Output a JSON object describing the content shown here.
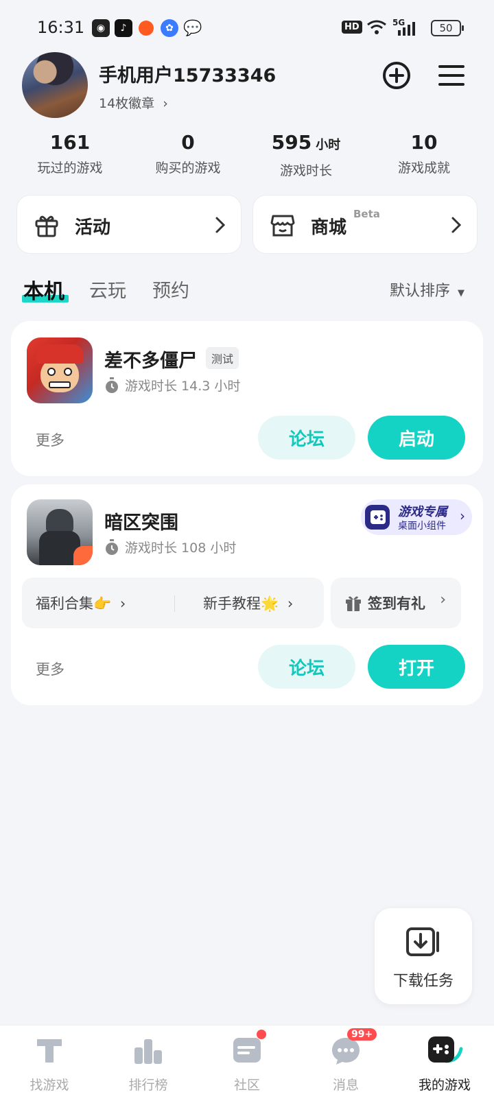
{
  "status": {
    "time": "16:31",
    "network": "5G",
    "battery": "50",
    "hd_label": "HD"
  },
  "profile": {
    "username": "手机用户15733346",
    "badges": "14枚徽章"
  },
  "stats": [
    {
      "value": "161",
      "unit": "",
      "label": "玩过的游戏"
    },
    {
      "value": "0",
      "unit": "",
      "label": "购买的游戏"
    },
    {
      "value": "595",
      "unit": "小时",
      "label": "游戏时长"
    },
    {
      "value": "10",
      "unit": "",
      "label": "游戏成就"
    }
  ],
  "shortcuts": {
    "activity": "活动",
    "store": "商城",
    "store_beta": "Beta"
  },
  "tabs": [
    {
      "label": "本机",
      "active": true
    },
    {
      "label": "云玩",
      "active": false
    },
    {
      "label": "预约",
      "active": false
    }
  ],
  "sort": "默认排序",
  "games": [
    {
      "name": "差不多僵尸",
      "tag": "测试",
      "playtime": "游戏时长 14.3 小时",
      "more": "更多",
      "forum": "论坛",
      "action": "启动"
    },
    {
      "name": "暗区突围",
      "playtime": "游戏时长 108 小时",
      "promo_title": "游戏专属",
      "promo_sub": "桌面小组件",
      "links": [
        "福利合集👉",
        "新手教程🌟"
      ],
      "signin": "签到有礼",
      "more": "更多",
      "forum": "论坛",
      "action": "打开"
    }
  ],
  "download": {
    "label": "下载任务"
  },
  "nav": [
    {
      "label": "找游戏",
      "icon": "find-game-icon"
    },
    {
      "label": "排行榜",
      "icon": "ranking-icon"
    },
    {
      "label": "社区",
      "icon": "community-icon"
    },
    {
      "label": "消息",
      "icon": "message-icon",
      "badge": "99+"
    },
    {
      "label": "我的游戏",
      "icon": "my-games-icon",
      "active": true
    }
  ],
  "colors": {
    "accent": "#14d2c4",
    "background": "#f4f5f8",
    "badge_red": "#ff4d4f"
  }
}
